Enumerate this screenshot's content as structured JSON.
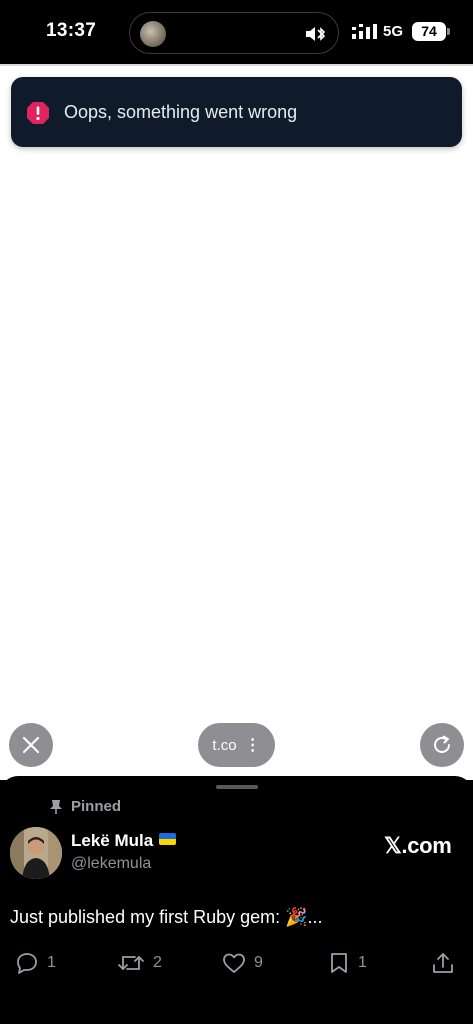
{
  "status_bar": {
    "time": "13:37",
    "network": "5G",
    "battery": "74",
    "icons": [
      "bluetooth-icon",
      "signal-icon"
    ]
  },
  "toast": {
    "message": "Oops, something went wrong",
    "icon": "error-icon",
    "accent": "#e0245e"
  },
  "browser": {
    "url": "t.co",
    "menu_glyph": "⋮",
    "close_icon": "close-icon",
    "reload_icon": "reload-icon"
  },
  "tweet": {
    "pinned_label": "Pinned",
    "user_name": "Lekë Mula",
    "handle": "@lekemula",
    "brand": "𝕏.com",
    "text": "Just published my first Ruby gem: 🎉...",
    "replies": "1",
    "retweets": "2",
    "likes": "9",
    "bookmarks": "1"
  }
}
